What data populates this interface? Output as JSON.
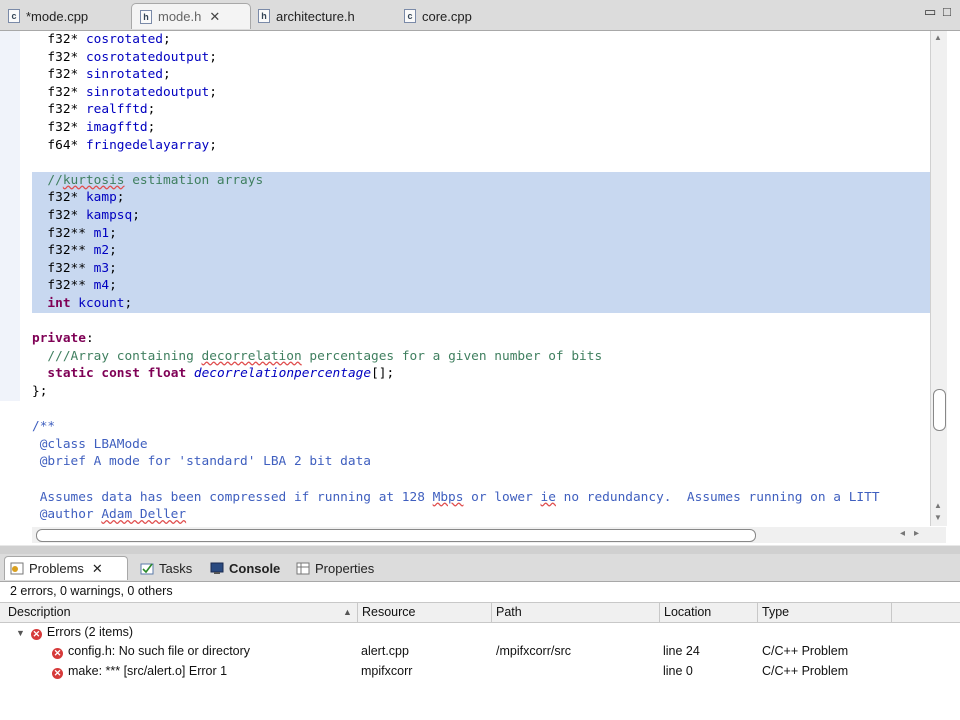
{
  "editor_tabs": [
    {
      "icon": "c",
      "label": "*mode.cpp"
    },
    {
      "icon": "h",
      "label": "mode.h"
    },
    {
      "icon": "h",
      "label": "architecture.h"
    },
    {
      "icon": "c",
      "label": "core.cpp"
    }
  ],
  "code": {
    "l1": {
      "type": "f32*",
      "name": "cosrotated"
    },
    "l2": {
      "type": "f32*",
      "name": "cosrotatedoutput"
    },
    "l3": {
      "type": "f32*",
      "name": "sinrotated"
    },
    "l4": {
      "type": "f32*",
      "name": "sinrotatedoutput"
    },
    "l5": {
      "type": "f32*",
      "name": "realfftd"
    },
    "l6": {
      "type": "f32*",
      "name": "imagfftd"
    },
    "l7": {
      "type": "f64*",
      "name": "fringedelayarray"
    },
    "c1a": "//",
    "c1b": "kurtosis",
    "c1c": " estimation arrays",
    "l8": {
      "type": "f32*",
      "name": "kamp"
    },
    "l9": {
      "type": "f32*",
      "name": "kampsq"
    },
    "l10": {
      "type": "f32**",
      "name": "m1"
    },
    "l11": {
      "type": "f32**",
      "name": "m2"
    },
    "l12": {
      "type": "f32**",
      "name": "m3"
    },
    "l13": {
      "type": "f32**",
      "name": "m4"
    },
    "l14": {
      "type": "int",
      "name": "kcount"
    },
    "private_kw": "private",
    "c2a": "///Array containing ",
    "c2b": "decorrelation",
    "c2c": " percentages for a given number of bits",
    "static_kw": "static",
    "const_kw": "const",
    "float_kw": "float",
    "decorr_name": "decorrelationpercentage",
    "decorr_tail": "[];",
    "close_brace": "};",
    "d1": "/**",
    "d2": " @class LBAMode",
    "d3": " @brief A mode for 'standard' LBA 2 bit data",
    "d4a": " Assumes data has been compressed if running at 128 ",
    "d4b": "Mbps",
    "d4c": " or lower ",
    "d4d": "ie",
    "d4e": " no redundancy.  Assumes running on a LITT",
    "d5a": " @author ",
    "d5b": "Adam Deller"
  },
  "panel_tabs": [
    {
      "label": "Problems"
    },
    {
      "label": "Tasks"
    },
    {
      "label": "Console"
    },
    {
      "label": "Properties"
    }
  ],
  "problems": {
    "summary": "2 errors, 0 warnings, 0 others",
    "columns": [
      "Description",
      "Resource",
      "Path",
      "Location",
      "Type"
    ],
    "group": "Errors (2 items)",
    "rows": [
      {
        "description": "config.h: No such file or directory",
        "resource": "alert.cpp",
        "path": "/mpifxcorr/src",
        "location": "line 24",
        "type": "C/C++ Problem"
      },
      {
        "description": "make: *** [src/alert.o] Error 1",
        "resource": "mpifxcorr",
        "path": "",
        "location": "line 0",
        "type": "C/C++ Problem"
      }
    ]
  }
}
